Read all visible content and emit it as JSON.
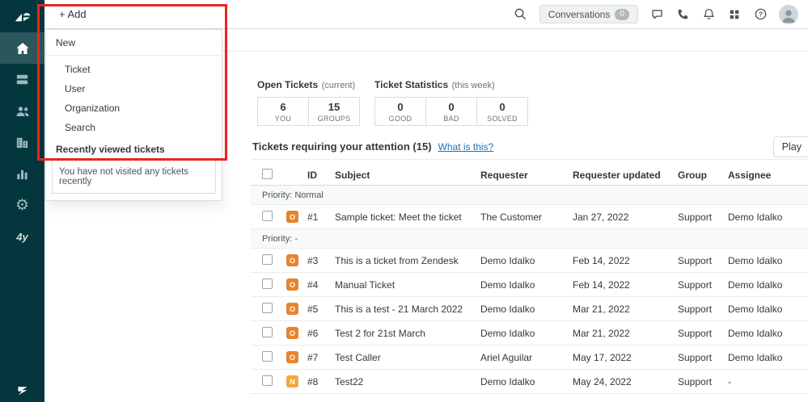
{
  "annotation": {
    "color": "#e8251f"
  },
  "sidebar": {
    "items": [
      "zendesk-logo",
      "home",
      "views",
      "customers",
      "organizations",
      "reporting",
      "admin",
      "app"
    ],
    "gear_glyph": "⚙",
    "app_glyph": "4y"
  },
  "topbar": {
    "add_label": "+ Add",
    "conversations": {
      "label": "Conversations",
      "badge": "0"
    }
  },
  "dropdown": {
    "new_header": "New",
    "items": [
      "Ticket",
      "User",
      "Organization",
      "Search"
    ],
    "recent_header": "Recently viewed tickets",
    "recent_empty": "You have not visited any tickets recently"
  },
  "stats_groups": [
    {
      "title": "Open Tickets",
      "subtitle": "(current)",
      "cells": [
        {
          "value": "6",
          "label": "YOU"
        },
        {
          "value": "15",
          "label": "GROUPS"
        }
      ]
    },
    {
      "title": "Ticket Statistics",
      "subtitle": "(this week)",
      "cells": [
        {
          "value": "0",
          "label": "GOOD"
        },
        {
          "value": "0",
          "label": "BAD"
        },
        {
          "value": "0",
          "label": "SOLVED"
        }
      ]
    }
  ],
  "attention": {
    "title": "Tickets requiring your attention (15)",
    "help_link": "What is this?",
    "play_label": "Play"
  },
  "table": {
    "columns": [
      "ID",
      "Subject",
      "Requester",
      "Requester updated",
      "Group",
      "Assignee"
    ],
    "status_colors": {
      "O": "#e8832e",
      "N": "#f0a83c"
    },
    "groups": [
      {
        "label": "Priority: Normal",
        "rows": [
          {
            "status": "O",
            "id": "#1",
            "subject": "Sample ticket: Meet the ticket",
            "requester": "The Customer",
            "updated": "Jan 27, 2022",
            "group": "Support",
            "assignee": "Demo Idalko"
          }
        ]
      },
      {
        "label": "Priority: -",
        "rows": [
          {
            "status": "O",
            "id": "#3",
            "subject": "This is a ticket from Zendesk",
            "requester": "Demo Idalko",
            "updated": "Feb 14, 2022",
            "group": "Support",
            "assignee": "Demo Idalko"
          },
          {
            "status": "O",
            "id": "#4",
            "subject": "Manual Ticket",
            "requester": "Demo Idalko",
            "updated": "Feb 14, 2022",
            "group": "Support",
            "assignee": "Demo Idalko"
          },
          {
            "status": "O",
            "id": "#5",
            "subject": "This is a test - 21 March 2022",
            "requester": "Demo Idalko",
            "updated": "Mar 21, 2022",
            "group": "Support",
            "assignee": "Demo Idalko"
          },
          {
            "status": "O",
            "id": "#6",
            "subject": "Test 2 for 21st March",
            "requester": "Demo Idalko",
            "updated": "Mar 21, 2022",
            "group": "Support",
            "assignee": "Demo Idalko"
          },
          {
            "status": "O",
            "id": "#7",
            "subject": "Test Caller",
            "requester": "Ariel Aguilar",
            "updated": "May 17, 2022",
            "group": "Support",
            "assignee": "Demo Idalko"
          },
          {
            "status": "N",
            "id": "#8",
            "subject": "Test22",
            "requester": "Demo Idalko",
            "updated": "May 24, 2022",
            "group": "Support",
            "assignee": "-"
          }
        ]
      }
    ]
  }
}
